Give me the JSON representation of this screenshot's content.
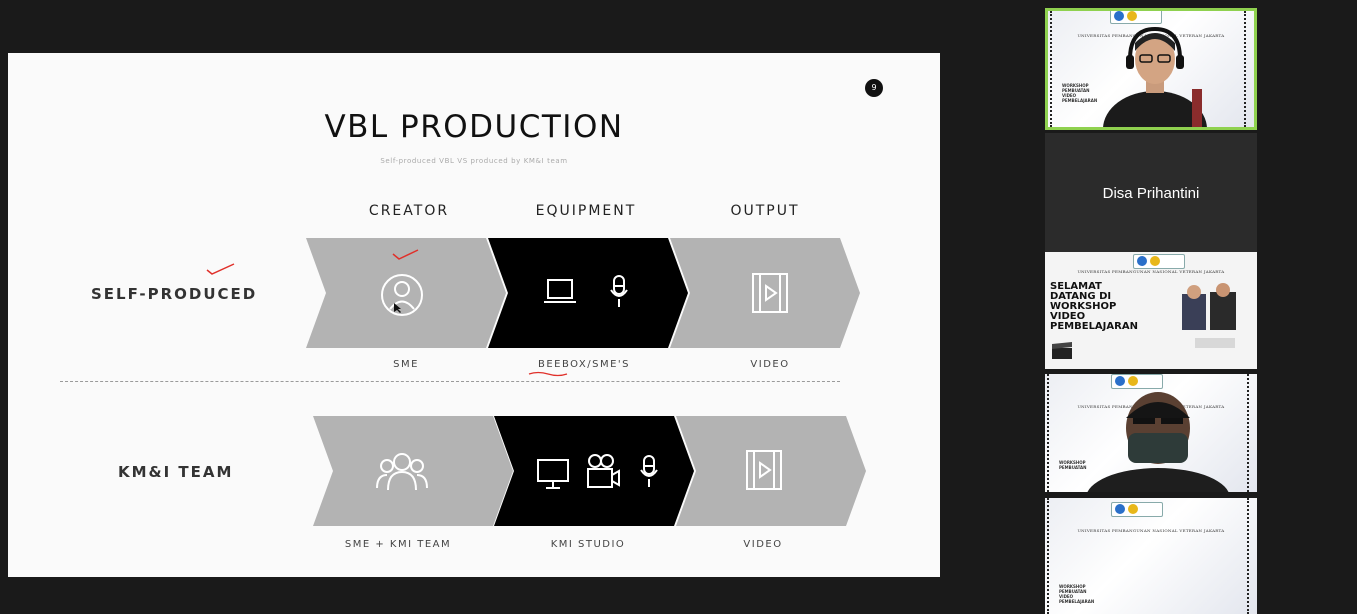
{
  "slide": {
    "page_number": "9",
    "title": "VBL PRODUCTION",
    "subtitle": "Self-produced VBL VS produced by KM&I team",
    "columns": [
      "CREATOR",
      "EQUIPMENT",
      "OUTPUT"
    ],
    "rows": [
      {
        "label": "SELF-PRODUCED",
        "captions": [
          "SME",
          "BEEBOX/SME'S",
          "VIDEO"
        ]
      },
      {
        "label": "KM&I TEAM",
        "captions": [
          "SME + KMI TEAM",
          "KMI STUDIO",
          "VIDEO"
        ]
      }
    ],
    "colors": {
      "gray_chevron": "#b3b3b3",
      "black_chevron": "#000000",
      "annotation": "#e0302a"
    }
  },
  "participants": {
    "active_speaker": {
      "border_color": "#8fd14f"
    },
    "name_tile": "Disa Prihantini",
    "tiles": [
      {
        "university": "UNIVERSITAS PEMBANGUNAN NASIONAL VETERAN JAKARTA",
        "tag": "WORKSHOP PEMBUATAN VIDEO PEMBELAJARAN"
      },
      {
        "university": "UNIVERSITAS PEMBANGUNAN NASIONAL VETERAN JAKARTA",
        "welcome": "SELAMAT DATANG DI WORKSHOP VIDEO PEMBELAJARAN"
      },
      {
        "university": "UNIVERSITAS PEMBANGUNAN NASIONAL VETERAN JAKARTA",
        "tag": "WORKSHOP PEMBUATAN"
      },
      {
        "university": "UNIVERSITAS PEMBANGUNAN NASIONAL VETERAN JAKARTA",
        "tag": "WORKSHOP PEMBUATAN VIDEO PEMBELAJARAN"
      }
    ]
  }
}
